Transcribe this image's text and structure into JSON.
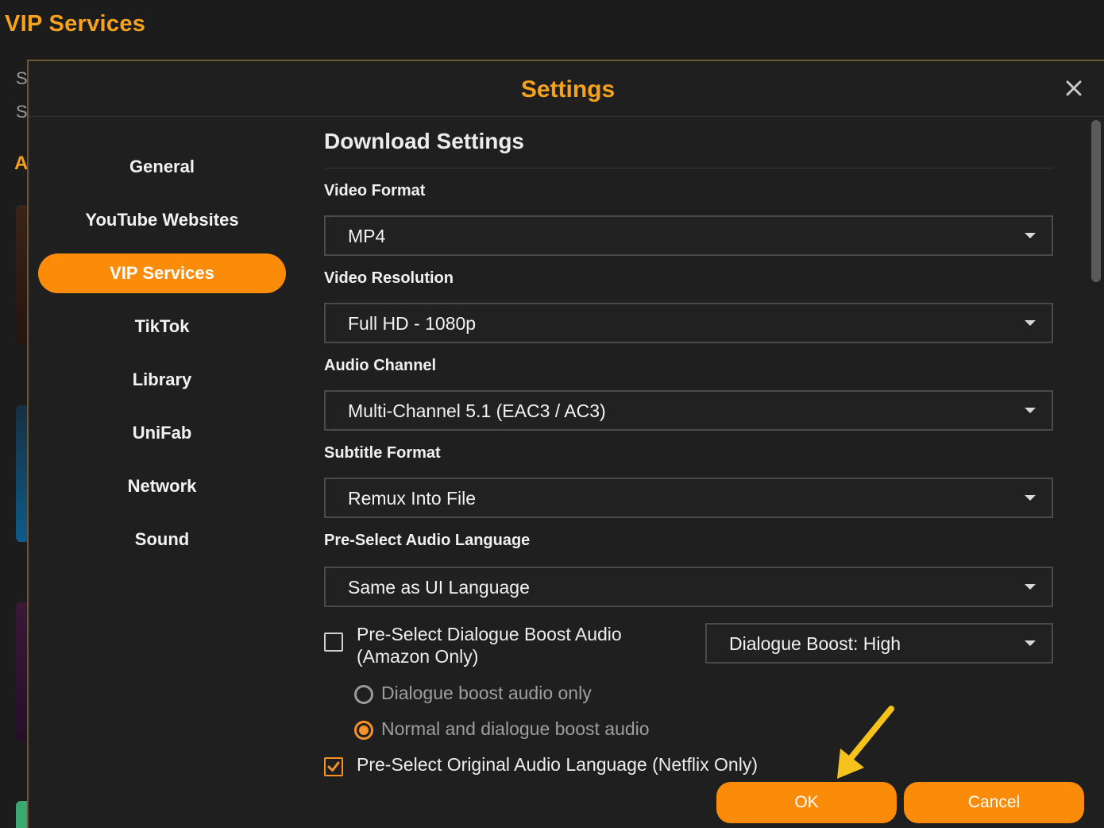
{
  "app": {
    "title": "VIP Services",
    "partial_letters": [
      "S",
      "S",
      "A"
    ]
  },
  "dialog": {
    "title": "Settings",
    "close_icon": "close-icon"
  },
  "nav": {
    "items": [
      {
        "label": "General",
        "active": false
      },
      {
        "label": "YouTube Websites",
        "active": false
      },
      {
        "label": "VIP Services",
        "active": true
      },
      {
        "label": "TikTok",
        "active": false
      },
      {
        "label": "Library",
        "active": false
      },
      {
        "label": "UniFab",
        "active": false
      },
      {
        "label": "Network",
        "active": false
      },
      {
        "label": "Sound",
        "active": false
      }
    ]
  },
  "download": {
    "section_title": "Download Settings",
    "video_format": {
      "label": "Video Format",
      "value": "MP4"
    },
    "video_resolution": {
      "label": "Video Resolution",
      "value": "Full HD - 1080p"
    },
    "audio_channel": {
      "label": "Audio Channel",
      "value": "Multi-Channel 5.1 (EAC3 / AC3)"
    },
    "subtitle_format": {
      "label": "Subtitle Format",
      "value": "Remux Into File"
    },
    "audio_language": {
      "label": "Pre-Select Audio Language",
      "value": "Same as UI Language"
    },
    "dialogue_boost": {
      "label_line1": "Pre-Select Dialogue Boost Audio",
      "label_line2": "(Amazon Only)",
      "checked": false,
      "level_value": "Dialogue Boost: High"
    },
    "boost_options": [
      {
        "label": "Dialogue boost audio only",
        "selected": false
      },
      {
        "label": "Normal and dialogue boost audio",
        "selected": true
      }
    ],
    "netflix_original": {
      "label": "Pre-Select Original Audio Language (Netflix Only)",
      "checked": true
    }
  },
  "buttons": {
    "ok": "OK",
    "cancel": "Cancel"
  },
  "colors": {
    "accent": "#f7a21b",
    "button": "#fb8c0a",
    "background": "#1c1c1c"
  }
}
